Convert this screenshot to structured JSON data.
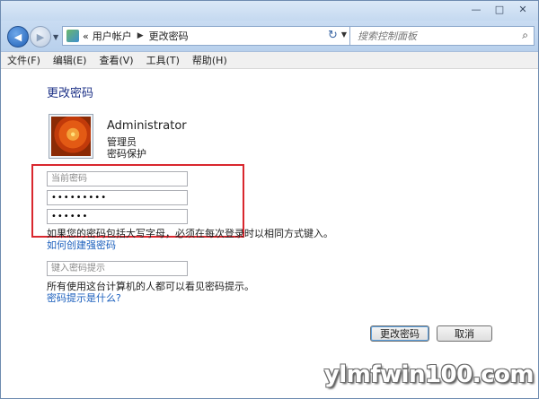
{
  "window": {
    "minimize": "—",
    "maximize": "□",
    "close": "✕"
  },
  "address": {
    "crumbs": [
      "用户帐户",
      "更改密码"
    ],
    "search_placeholder": "搜索控制面板"
  },
  "menu": [
    "文件(F)",
    "编辑(E)",
    "查看(V)",
    "工具(T)",
    "帮助(H)"
  ],
  "page": {
    "title": "更改密码",
    "user": {
      "name": "Administrator",
      "role": "管理员",
      "status": "密码保护"
    },
    "current_password_placeholder": "当前密码",
    "new_password_value": "•••••••••",
    "confirm_password_value": "••••••",
    "caps_note": "如果您的密码包括大写字母，必须在每次登录时以相同方式键入。",
    "strong_password_link": "如何创建强密码",
    "hint_placeholder": "键入密码提示",
    "hint_note": "所有使用这台计算机的人都可以看见密码提示。",
    "hint_link": "密码提示是什么?"
  },
  "buttons": {
    "change": "更改密码",
    "cancel": "取消"
  },
  "watermark": "ylmfwin100.com",
  "colors": {
    "highlight": "#d9272e",
    "link": "#1b5fbd",
    "title": "#1e3287"
  }
}
